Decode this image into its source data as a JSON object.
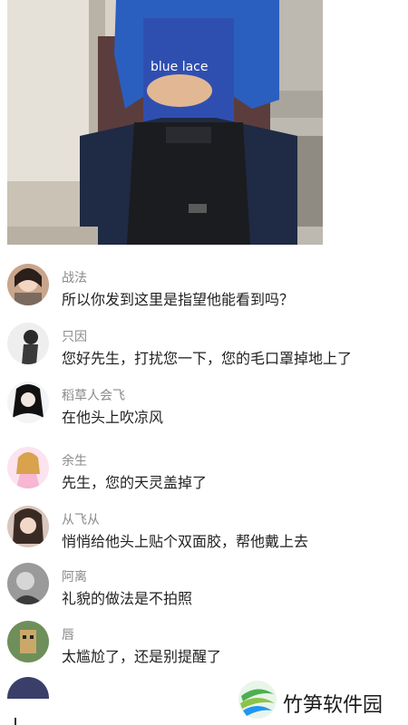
{
  "photo": {
    "bag_text": "blue lace"
  },
  "comments": [
    {
      "name": "战法",
      "text": "所以你发到这里是指望他能看到吗？"
    },
    {
      "name": "只因",
      "text": "您好先生，打扰您一下，您的毛口罩掉地上了"
    },
    {
      "name": "稻草人会飞",
      "text": "在他头上吹凉风"
    },
    {
      "name": "余生",
      "text": "先生，您的天灵盖掉了"
    },
    {
      "name": "从飞从",
      "text": "悄悄给他头上贴个双面胶，帮他戴上去"
    },
    {
      "name": "阿离",
      "text": "礼貌的做法是不拍照"
    },
    {
      "name": "唇",
      "text": "太尴尬了，还是别提醒了"
    }
  ],
  "watermark": {
    "text": "竹笋软件园"
  },
  "colors": {
    "name_gray": "#8a8a8a",
    "text_dark": "#222222",
    "jacket_blue": "#2a5fbf",
    "logo_green": "#4caf50",
    "logo_blue": "#2196f3"
  }
}
